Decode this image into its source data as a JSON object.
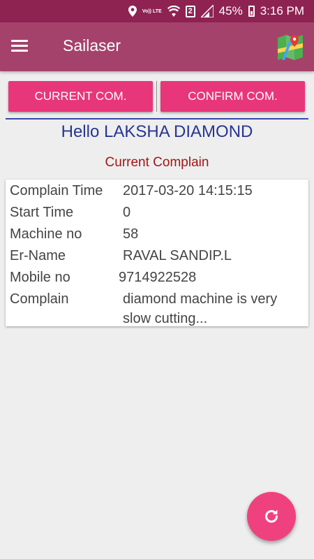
{
  "status_bar": {
    "network_label": "Vo)) LTE",
    "sim_label": "2",
    "battery_percent": "45%",
    "time": "3:16 PM",
    "icons": [
      "location-icon",
      "volte-icon",
      "wifi-icon",
      "sim2-icon",
      "signal-icon",
      "battery-icon"
    ]
  },
  "app_bar": {
    "title": "Sailaser",
    "menu_icon": "hamburger-menu-icon",
    "map_icon": "map-pin-icon"
  },
  "tabs": {
    "current_label": "CURRENT COM.",
    "confirm_label": "CONFIRM COM."
  },
  "greeting": "Hello LAKSHA DIAMOND",
  "section_title": "Current Complain",
  "details": [
    {
      "label": "Complain Time",
      "value": "2017-03-20 14:15:15"
    },
    {
      "label": "Start Time",
      "value": "0"
    },
    {
      "label": "Machine no",
      "value": "58"
    },
    {
      "label": "Er-Name",
      "value": "RAVAL SANDIP.L"
    },
    {
      "label": "Mobile no",
      "value": "9714922528"
    },
    {
      "label": "Complain",
      "value": "diamond machine is very slow cutting..."
    }
  ],
  "fab": {
    "icon": "refresh-icon"
  },
  "colors": {
    "status_bar": "#8e2352",
    "app_bar": "#a5426b",
    "button": "#e8367a",
    "greeting": "#283593",
    "section_title": "#a31515",
    "fab": "#f0417f"
  }
}
